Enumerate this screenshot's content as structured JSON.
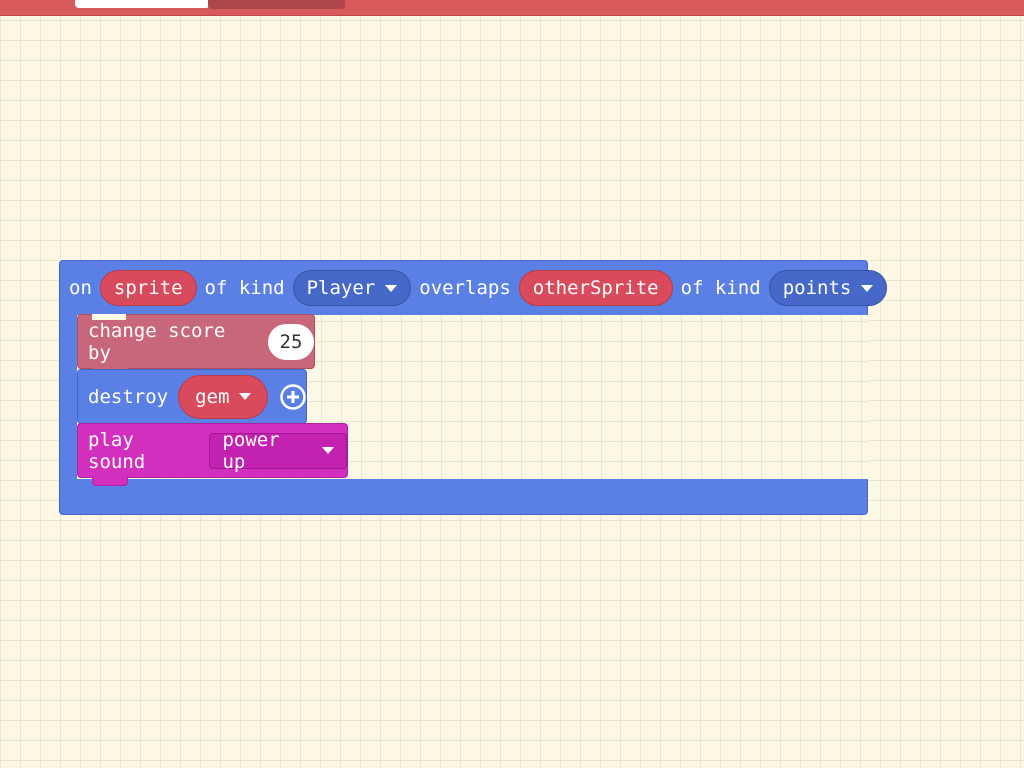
{
  "colors": {
    "topbar": "#d85a5a",
    "workspace_bg": "#fdf8e6",
    "sprites_block": "#5b80e5",
    "info_block": "#c9677a",
    "music_block": "#d22fbf",
    "sprite_variable": "#d94b5c",
    "dropdown": "#4568c9"
  },
  "event_block": {
    "on_label": "on",
    "sprite_var": "sprite",
    "of_kind_label_1": "of kind",
    "kind_1": "Player",
    "overlaps_label": "overlaps",
    "other_var": "otherSprite",
    "of_kind_label_2": "of kind",
    "kind_2": "points"
  },
  "statements": {
    "score": {
      "label": "change score by",
      "value": "25"
    },
    "destroy": {
      "label": "destroy",
      "target": "gem",
      "expand_icon": "plus-circle-icon"
    },
    "sound": {
      "label": "play sound",
      "sound": "power up"
    }
  }
}
